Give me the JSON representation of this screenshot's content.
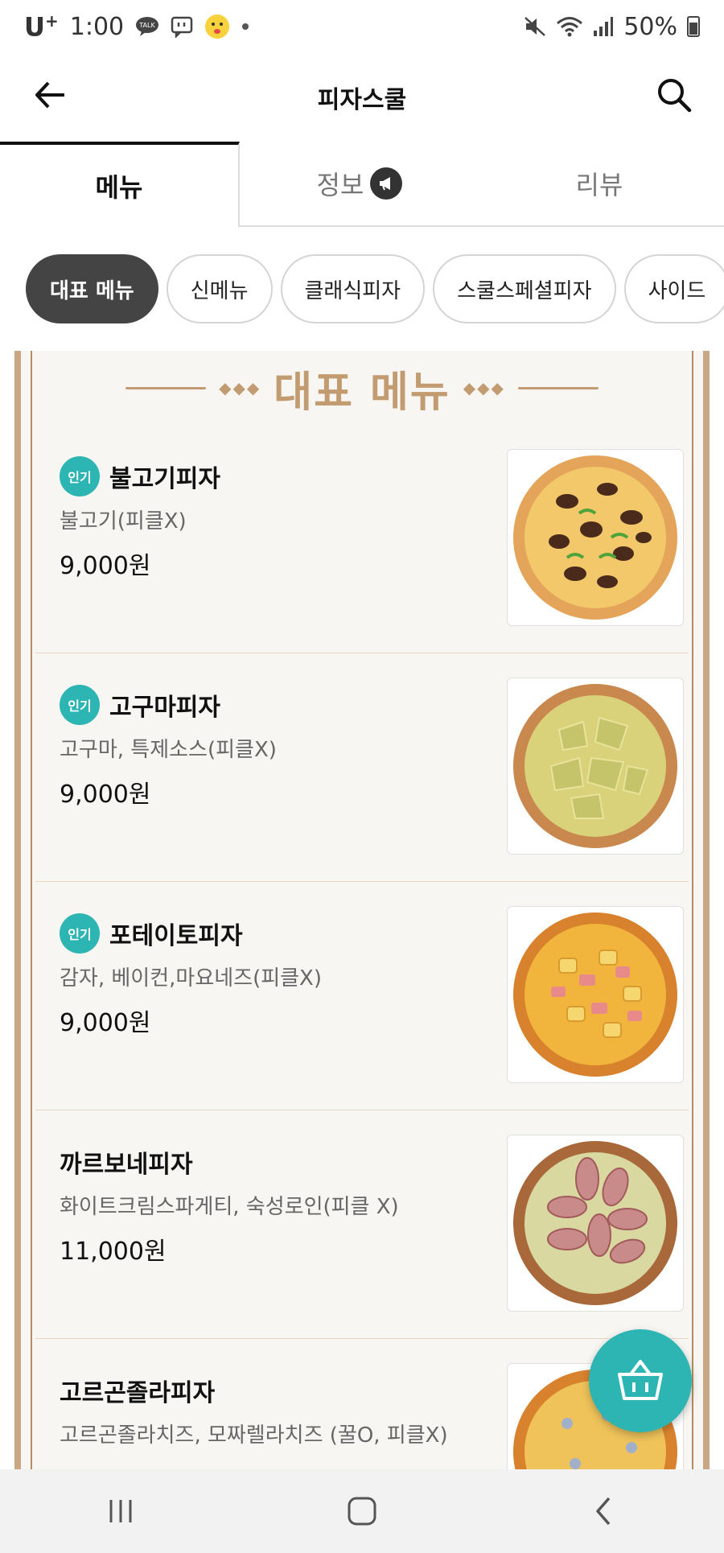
{
  "status_bar": {
    "carrier": "U",
    "carrier_sup": "+",
    "time": "1:00",
    "battery": "50%",
    "icons": [
      "talk-icon",
      "message-icon",
      "emoji-icon",
      "dot-icon",
      "mute-icon",
      "wifi-icon",
      "signal-icon",
      "battery-icon"
    ]
  },
  "header": {
    "title": "피자스쿨",
    "back_icon": "arrow-left-icon",
    "search_icon": "search-icon"
  },
  "tabs": [
    {
      "label": "메뉴",
      "active": true
    },
    {
      "label": "정보",
      "active": false,
      "icon": "megaphone-icon"
    },
    {
      "label": "리뷰",
      "active": false
    }
  ],
  "chips": [
    {
      "label": "대표 메뉴",
      "active": true
    },
    {
      "label": "신메뉴",
      "active": false
    },
    {
      "label": "클래식피자",
      "active": false
    },
    {
      "label": "스쿨스페셜피자",
      "active": false
    },
    {
      "label": "사이드",
      "active": false
    }
  ],
  "section": {
    "title": "대표 메뉴",
    "decoration": "◆◆◆"
  },
  "menu_items": [
    {
      "name": "불고기피자",
      "badge": "인기",
      "desc": "불고기(피클X)",
      "price": "9,000원",
      "photo": "bulgogi-pizza"
    },
    {
      "name": "고구마피자",
      "badge": "인기",
      "desc": "고구마, 특제소스(피클X)",
      "price": "9,000원",
      "photo": "sweet-potato-pizza"
    },
    {
      "name": "포테이토피자",
      "badge": "인기",
      "desc": "감자, 베이컨,마요네즈(피클X)",
      "price": "9,000원",
      "photo": "potato-pizza"
    },
    {
      "name": "까르보네피자",
      "badge": "",
      "desc": "화이트크림스파게티, 숙성로인(피클 X)",
      "price": "11,000원",
      "photo": "carbonara-pizza"
    },
    {
      "name": "고르곤졸라피자",
      "badge": "",
      "desc": "고르곤졸라치즈, 모짜렐라치즈 (꿀O, 피클X)",
      "price": "",
      "photo": "gorgonzola-pizza"
    }
  ],
  "colors": {
    "accent_teal": "#2cb5b2",
    "gold": "#c39b70",
    "chip_active": "#444444"
  },
  "fab": {
    "icon": "cart-icon"
  },
  "nav": {
    "icons": [
      "recent-apps-icon",
      "home-icon",
      "back-icon"
    ]
  }
}
